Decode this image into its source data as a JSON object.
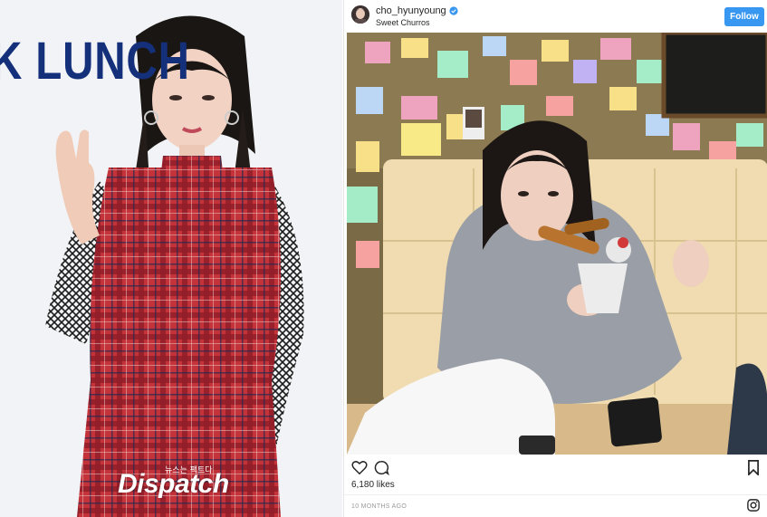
{
  "left_photo": {
    "background_sign": "K LUNCH",
    "watermark_small": "뉴스는 팩트다",
    "watermark_brand": "Dispatch"
  },
  "instagram_post": {
    "username": "cho_hyunyoung",
    "location": "Sweet Churros",
    "follow_label": "Follow",
    "likes": "6,180 likes",
    "timestamp": "10 MONTHS AGO",
    "accent_color": "#3897f0"
  }
}
